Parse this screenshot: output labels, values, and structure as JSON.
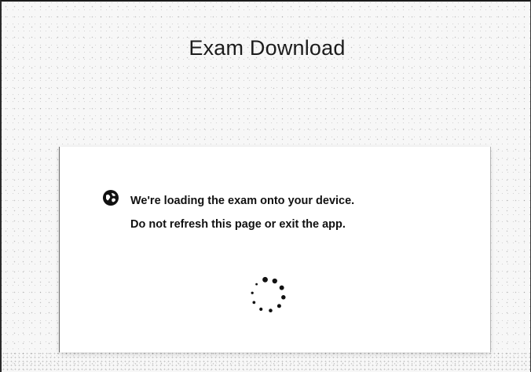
{
  "header": {
    "title": "Exam Download"
  },
  "loading_card": {
    "line1": "We're loading the exam onto your device.",
    "line2": "Do not refresh this page or exit the app.",
    "status_icon": "globe-icon",
    "spinner_icon": "loading-spinner-icon"
  },
  "colors": {
    "background": "#f7f7f7",
    "card": "#ffffff",
    "text": "#111111"
  }
}
